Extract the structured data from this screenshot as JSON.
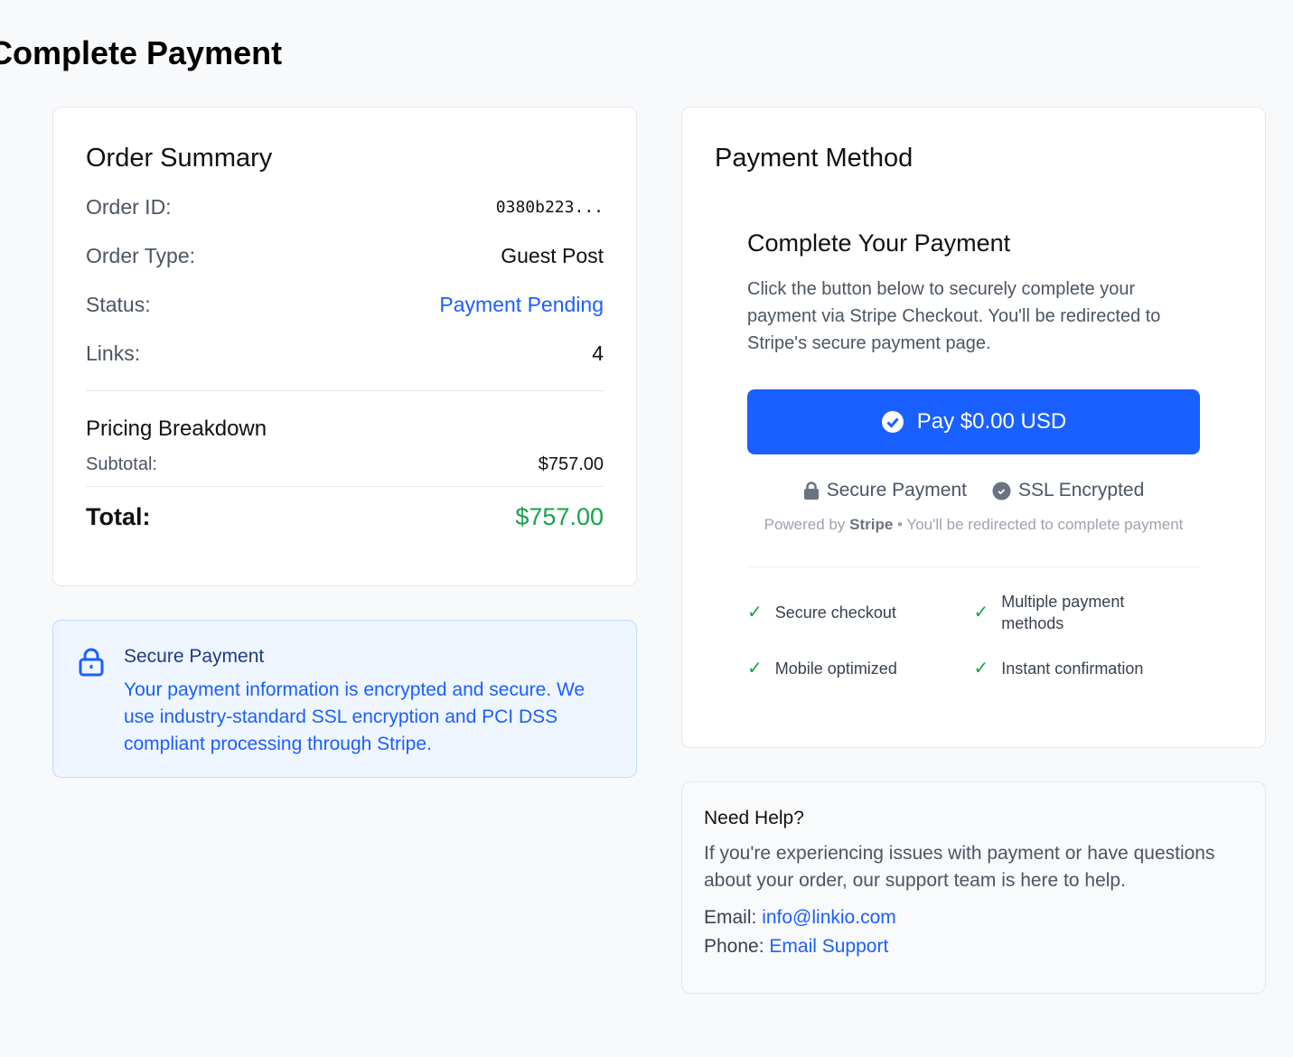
{
  "page_title": "Complete Payment",
  "order": {
    "title": "Order Summary",
    "rows": [
      {
        "label": "Order ID:",
        "value": "0380b223..."
      },
      {
        "label": "Order Type:",
        "value": "Guest Post"
      },
      {
        "label": "Status:",
        "value": "Payment Pending"
      },
      {
        "label": "Links:",
        "value": "4"
      }
    ],
    "pricing_title": "Pricing Breakdown",
    "subtotal_label": "Subtotal:",
    "subtotal": "$757.00",
    "total_label": "Total:",
    "total": "$757.00"
  },
  "secure": {
    "title": "Secure Payment",
    "text": "Your payment information is encrypted and secure. We use industry-standard SSL encryption and PCI DSS compliant processing through Stripe."
  },
  "payment": {
    "title": "Payment Method",
    "heading": "Complete Your Payment",
    "text": "Click the button below to securely complete your payment via Stripe Checkout. You'll be redirected to Stripe's secure payment page.",
    "button": "Pay $0.00 USD",
    "badge1": "Secure Payment",
    "badge2": "SSL Encrypted",
    "powered_prefix": "Powered by",
    "powered_brand": "Stripe",
    "powered_suffix": "• You'll be redirected to complete payment",
    "features": [
      "Secure checkout",
      "Multiple payment methods",
      "Mobile optimized",
      "Instant confirmation"
    ]
  },
  "help": {
    "title": "Need Help?",
    "text": "If you're experiencing issues with payment or have questions about your order, our support team is here to help.",
    "email_label": "Email:",
    "email": "info@linkio.com",
    "phone_label": "Phone:",
    "phone": "Email Support"
  },
  "colors": {
    "accent": "#1a5fff",
    "success": "#16a34a"
  }
}
